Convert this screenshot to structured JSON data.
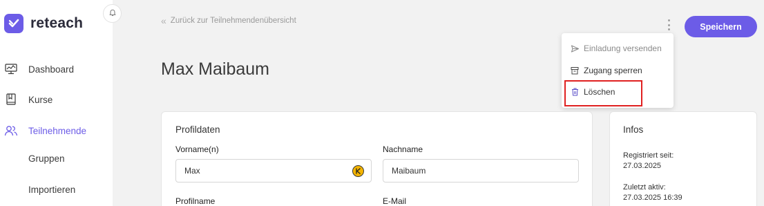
{
  "brand": {
    "name": "reteach",
    "accent": "#6c5ce7"
  },
  "sidebar": {
    "items": [
      {
        "label": "Dashboard",
        "icon": "monitor-chart-icon"
      },
      {
        "label": "Kurse",
        "icon": "book-icon"
      },
      {
        "label": "Teilnehmende",
        "icon": "users-icon",
        "active": true
      },
      {
        "label": "Gruppen"
      },
      {
        "label": "Importieren"
      }
    ]
  },
  "header": {
    "back_label": "Zurück zur Teilnehmendenübersicht",
    "title": "Max Maibaum",
    "save_label": "Speichern"
  },
  "menu": {
    "items": [
      {
        "label": "Einladung versenden",
        "icon": "send-icon",
        "disabled": true
      },
      {
        "label": "Zugang sperren",
        "icon": "archive-icon"
      },
      {
        "label": "Löschen",
        "icon": "trash-icon"
      }
    ]
  },
  "profile": {
    "title": "Profildaten",
    "first_name_label": "Vorname(n)",
    "first_name_value": "Max",
    "last_name_label": "Nachname",
    "last_name_value": "Maibaum",
    "profile_name_label": "Profilname",
    "email_label": "E-Mail"
  },
  "info": {
    "title": "Infos",
    "registered_label": "Registriert seit:",
    "registered_value": "27.03.2025",
    "last_active_label": "Zuletzt aktiv:",
    "last_active_value": "27.03.2025 16:39"
  }
}
